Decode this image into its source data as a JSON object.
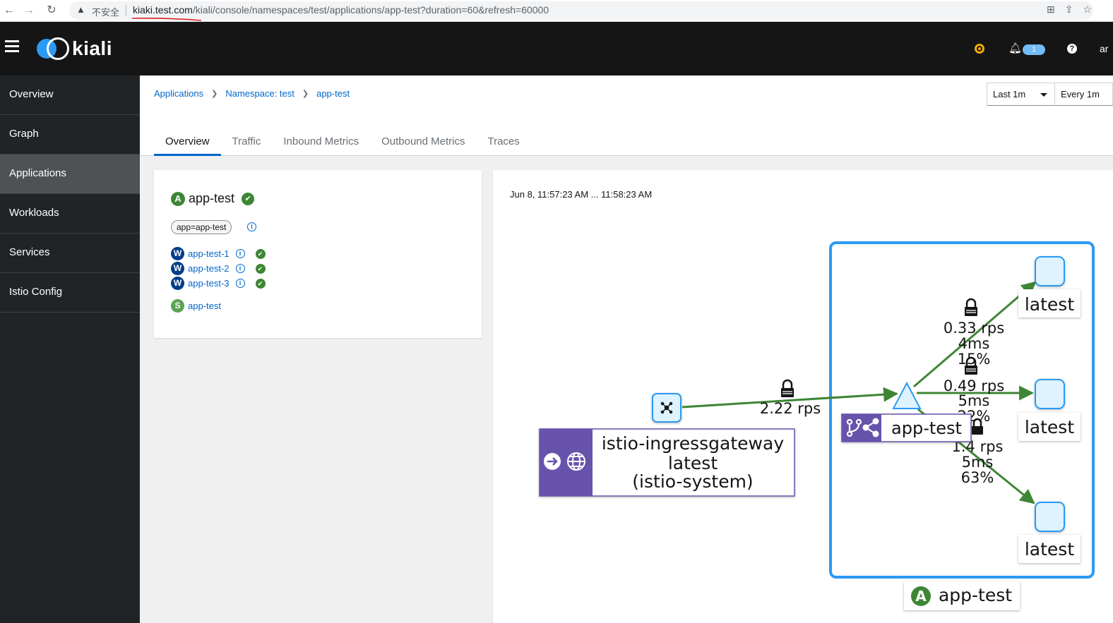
{
  "browser": {
    "insecure_label": "不安全",
    "url_host": "kiaki.test.com",
    "url_path": "/kiali/console/namespaces/test/applications/app-test?duration=60&refresh=60000"
  },
  "masthead": {
    "logo_text": "kiali",
    "notification_count": "1",
    "help_glyph": "?",
    "user_partial": "ar"
  },
  "sidebar": {
    "items": [
      {
        "label": "Overview",
        "active": false
      },
      {
        "label": "Graph",
        "active": false
      },
      {
        "label": "Applications",
        "active": true
      },
      {
        "label": "Workloads",
        "active": false
      },
      {
        "label": "Services",
        "active": false
      },
      {
        "label": "Istio Config",
        "active": false
      }
    ]
  },
  "breadcrumb": {
    "items": [
      "Applications",
      "Namespace: test",
      "app-test"
    ]
  },
  "time": {
    "range": "Last 1m",
    "refresh": "Every 1m"
  },
  "tabs": [
    "Overview",
    "Traffic",
    "Inbound Metrics",
    "Outbound Metrics",
    "Traces"
  ],
  "app_card": {
    "badge": "A",
    "title": "app-test",
    "label": "app=app-test",
    "workloads": [
      {
        "badge": "W",
        "name": "app-test-1"
      },
      {
        "badge": "W",
        "name": "app-test-2"
      },
      {
        "badge": "W",
        "name": "app-test-3"
      }
    ],
    "service": {
      "badge": "S",
      "name": "app-test"
    }
  },
  "graph": {
    "time_range": "Jun 8, 11:57:23 AM ... 11:58:23 AM",
    "gateway": {
      "name": "istio-ingressgateway",
      "version": "latest",
      "namespace": "(istio-system)"
    },
    "gateway_edge": {
      "rps": "2.22 rps"
    },
    "app_node_label": "app-test",
    "box_label": "app-test",
    "box_badge": "A",
    "versions": [
      "latest",
      "latest",
      "latest"
    ],
    "edges": [
      {
        "rps": "0.33 rps",
        "latency": "4ms",
        "pct": "15%"
      },
      {
        "rps": "0.49 rps",
        "latency": "5ms",
        "pct": "22%"
      },
      {
        "rps": "1.4 rps",
        "latency": "5ms",
        "pct": "63%"
      }
    ]
  },
  "colors": {
    "accent": "#0066cc",
    "edge_green": "#3e8635",
    "box_blue": "#2b9af3",
    "node_fill": "#def3ff",
    "purple": "#6753ac",
    "masthead": "#151515",
    "sidebar": "#212427"
  }
}
